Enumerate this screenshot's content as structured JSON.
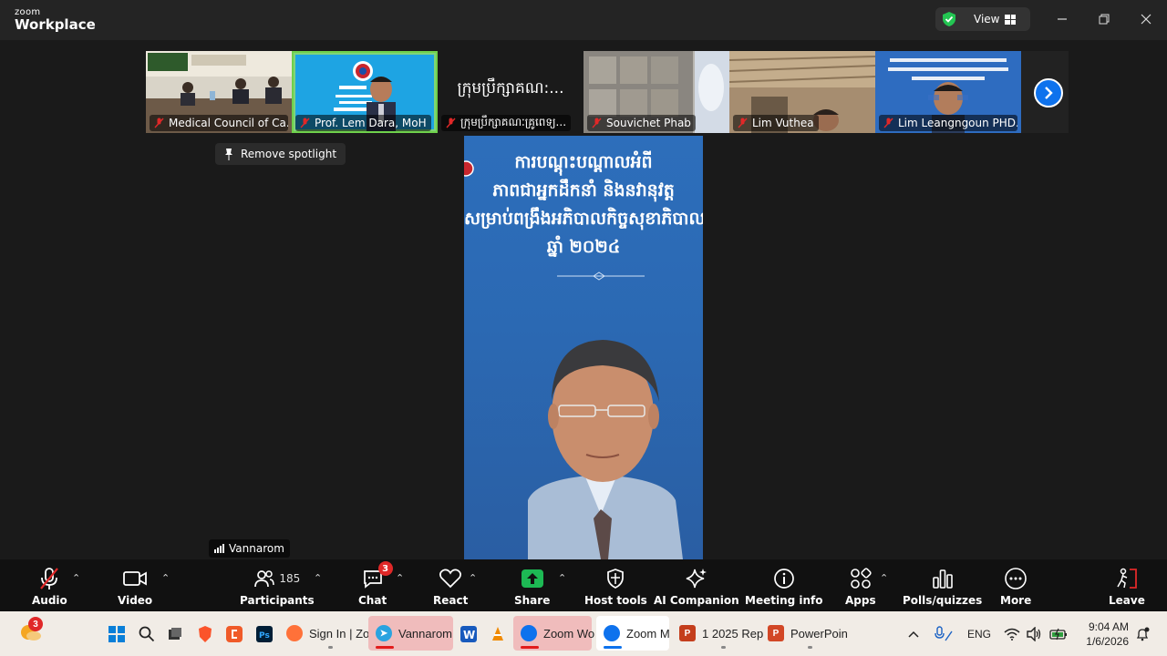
{
  "window": {
    "brand_line1": "zoom",
    "brand_line2": "Workplace",
    "view_label": "View"
  },
  "strip": {
    "participants": [
      {
        "name": "Medical Council of Ca..."
      },
      {
        "name": "Prof. Lem Dara, MoH"
      },
      {
        "name": "ក្រុមប្រឹក្សាគណៈគ្រូពេទ្យ...",
        "tile_text": "ក្រុមប្រឹក្សាគណ:..."
      },
      {
        "name": "Souvichet Phab"
      },
      {
        "name": "Lim Vuthea"
      },
      {
        "name": "Lim Leangngoun PHD..."
      }
    ]
  },
  "stage": {
    "remove_spotlight": "Remove spotlight",
    "speaker_name": "Vannarom",
    "slide_lines": [
      "ការបណ្តុះបណ្តាលអំពី",
      "ភាពជាអ្នកដឹកនាំ និងនវានុវត្ត",
      "សម្រាប់ពង្រឹងអភិបាលកិច្ចសុខាភិបាល",
      "ឆ្នាំ ២០២៤"
    ]
  },
  "toolbar": {
    "audio": "Audio",
    "video": "Video",
    "participants": "Participants",
    "participants_count": "185",
    "chat": "Chat",
    "chat_badge": "3",
    "react": "React",
    "share": "Share",
    "host_tools": "Host tools",
    "ai_companion": "AI Companion",
    "meeting_info": "Meeting info",
    "apps": "Apps",
    "polls": "Polls/quizzes",
    "more": "More",
    "leave": "Leave"
  },
  "taskbar": {
    "weather_badge": "3",
    "apps": [
      {
        "label": "Sign In | Zo"
      },
      {
        "label": "Vannarom"
      },
      {
        "label": "Zoom Wo"
      },
      {
        "label": "Zoom M"
      },
      {
        "label": "1 2025 Rep"
      },
      {
        "label": "PowerPoin"
      }
    ],
    "lang": "ENG",
    "time": "9:04 AM",
    "date": "1/6/2026"
  },
  "colors": {
    "accent_blue": "#0e72ed",
    "share_green": "#1db954",
    "active_speaker_green": "#6fd14b",
    "muted_red": "#e02828"
  }
}
